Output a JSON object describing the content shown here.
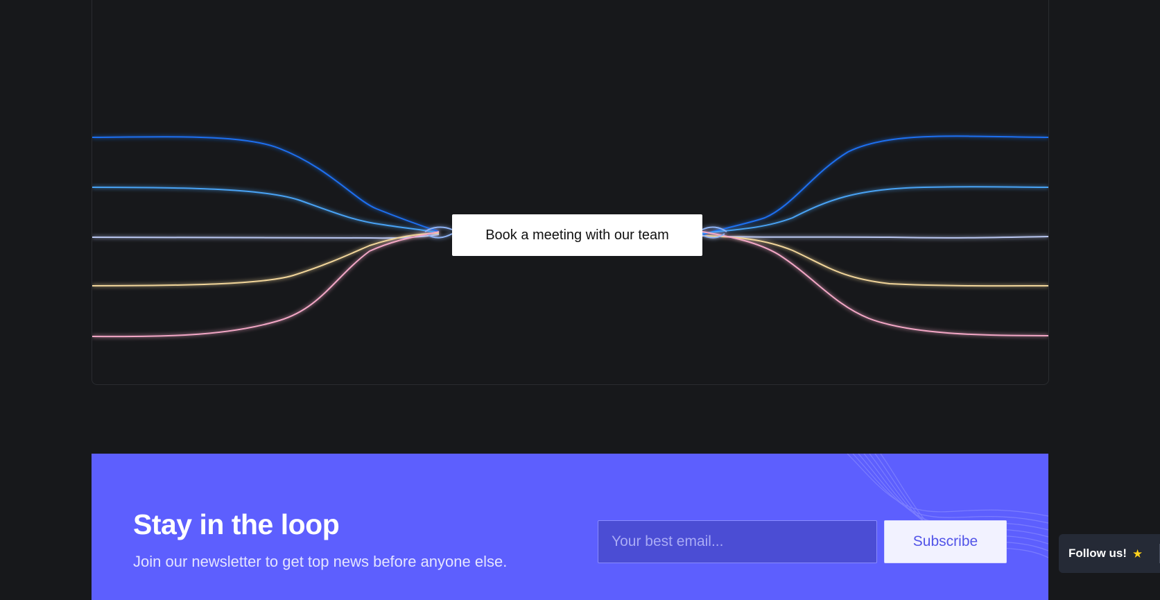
{
  "hero": {
    "cta_label": "Book a meeting with our team",
    "line_colors": [
      "#1e6ff0",
      "#4aa3f5",
      "#b9c6f0",
      "#f1d59a",
      "#f3a7c6"
    ]
  },
  "newsletter": {
    "title": "Stay in the loop",
    "subtitle": "Join our newsletter to get top news before anyone else.",
    "email_placeholder": "Your best email...",
    "subscribe_label": "Subscribe",
    "background_color": "#5d5ffe"
  },
  "follow": {
    "label": "Follow us!",
    "icon": "star-icon"
  }
}
